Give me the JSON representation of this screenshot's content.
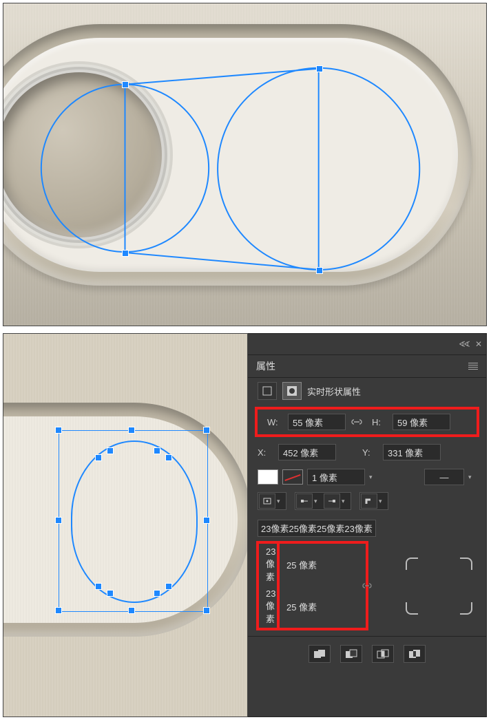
{
  "panel": {
    "title": "属性",
    "subtitle": "实时形状属性",
    "size": {
      "w_label": "W:",
      "w_value": "55 像素",
      "link_icon": "link-icon",
      "h_label": "H:",
      "h_value": "59 像素"
    },
    "pos": {
      "x_label": "X:",
      "x_value": "452 像素",
      "y_label": "Y:",
      "y_value": "331 像素"
    },
    "stroke": {
      "weight_value": "1 像素"
    },
    "corners": {
      "summary": "23像素25像素25像素23像素",
      "tl": "23 像素",
      "tr": "25 像素",
      "bl": "23 像素",
      "br": "25 像素"
    }
  },
  "icons": {
    "close": "✕",
    "collapse": "«",
    "menu": "≡",
    "link": "⧉",
    "dropdown": "▾",
    "dash": "—"
  }
}
